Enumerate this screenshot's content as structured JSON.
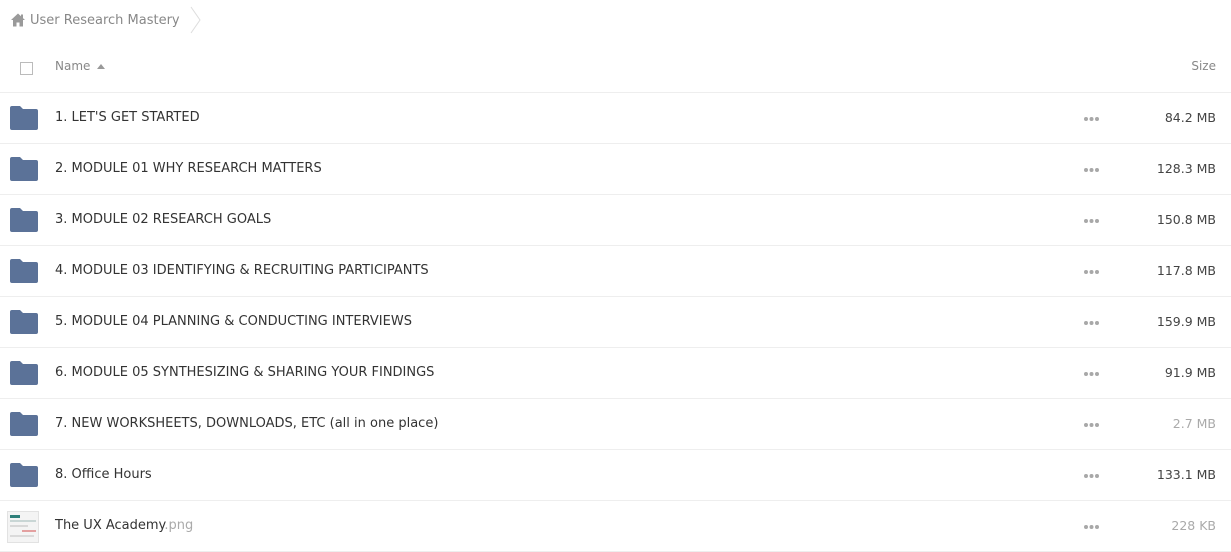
{
  "breadcrumb": {
    "home_icon": "home-icon",
    "current": "User Research Mastery"
  },
  "header": {
    "name_label": "Name",
    "size_label": "Size",
    "sort": "ascending"
  },
  "colors": {
    "folder": "#5b7298",
    "separator": "#eeeeee",
    "muted_text": "#aaaaaa"
  },
  "rows": [
    {
      "type": "folder",
      "name": "1. LET'S GET STARTED",
      "ext": "",
      "size": "84.2 MB"
    },
    {
      "type": "folder",
      "name": "2. MODULE 01 WHY RESEARCH MATTERS",
      "ext": "",
      "size": "128.3 MB"
    },
    {
      "type": "folder",
      "name": "3. MODULE 02 RESEARCH GOALS",
      "ext": "",
      "size": "150.8 MB"
    },
    {
      "type": "folder",
      "name": "4. MODULE 03 IDENTIFYING & RECRUITING PARTICIPANTS",
      "ext": "",
      "size": "117.8 MB"
    },
    {
      "type": "folder",
      "name": "5. MODULE 04 PLANNING & CONDUCTING INTERVIEWS",
      "ext": "",
      "size": "159.9 MB"
    },
    {
      "type": "folder",
      "name": "6. MODULE 05 SYNTHESIZING & SHARING YOUR FINDINGS",
      "ext": "",
      "size": "91.9 MB"
    },
    {
      "type": "folder",
      "name": "7. NEW WORKSHEETS, DOWNLOADS, ETC (all in one place)",
      "ext": "",
      "size": "2.7 MB"
    },
    {
      "type": "folder",
      "name": "8. Office Hours",
      "ext": "",
      "size": "133.1 MB"
    },
    {
      "type": "image",
      "name": "The UX Academy",
      "ext": ".png",
      "size": "228 KB"
    }
  ]
}
